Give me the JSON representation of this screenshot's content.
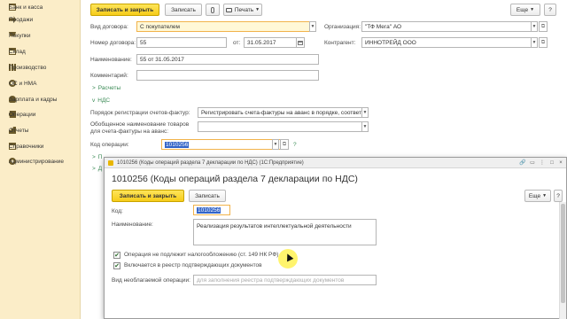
{
  "sidebar": {
    "items": [
      {
        "label": "Банк и касса",
        "icon": "bank-icon"
      },
      {
        "label": "Продажи",
        "icon": "sales-icon"
      },
      {
        "label": "Покупки",
        "icon": "purchases-icon"
      },
      {
        "label": "Склад",
        "icon": "warehouse-icon"
      },
      {
        "label": "Производство",
        "icon": "production-icon"
      },
      {
        "label": "ОС и НМА",
        "icon": "assets-icon"
      },
      {
        "label": "Зарплата и кадры",
        "icon": "hr-icon"
      },
      {
        "label": "Операции",
        "icon": "operations-icon"
      },
      {
        "label": "Отчеты",
        "icon": "reports-icon"
      },
      {
        "label": "Справочники",
        "icon": "directories-icon"
      },
      {
        "label": "Администрирование",
        "icon": "admin-icon"
      }
    ]
  },
  "toolbar": {
    "save_close": "Записать и закрыть",
    "save": "Записать",
    "print": "Печать",
    "more": "Еще",
    "help": "?"
  },
  "form": {
    "contract_type_label": "Вид договора:",
    "contract_type_value": "С покупателем",
    "organization_label": "Организация:",
    "organization_value": "\"ТФ Мега\" АО",
    "contract_no_label": "Номер договора:",
    "contract_no_value": "55",
    "from_label": "от:",
    "date_value": "31.05.2017",
    "counterparty_label": "Контрагент:",
    "counterparty_value": "ИННОТРЕЙД ООО",
    "name_label": "Наименование:",
    "name_value": "55 от 31.05.2017",
    "comment_label": "Комментарий:",
    "comment_value": "",
    "section_calc": "Расчеты",
    "section_vat": "НДС",
    "invoice_reg_label": "Порядок регистрации счетов-фактур:",
    "invoice_reg_value": "Регистрировать счета-фактуры на аванс в порядке, соответству",
    "goods_name_label": "Обобщенное наименование товаров для счета-фактуры на аванс:",
    "goods_name_value": "",
    "op_code_label": "Код операции:",
    "op_code_value": "1010256",
    "help_mark": "?",
    "hidden_section_1": "П",
    "hidden_section_2": "Д"
  },
  "dialog": {
    "window_title": "1010256 (Коды операций раздела 7 декларации по НДС) (1С:Предприятие)",
    "title": "1010256 (Коды операций раздела 7 декларации по НДС)",
    "save_close": "Записать и закрыть",
    "save": "Записать",
    "more": "Еще",
    "help": "?",
    "code_label": "Код:",
    "code_value": "1010256",
    "name_label": "Наименование:",
    "name_value": "Реализация результатов интеллектуальной деятельности",
    "check1_label": "Операция не подлежит налогообложению (ст. 149 НК РФ)",
    "check1_checked": true,
    "check2_label": "Включается в реестр подтверждающих документов",
    "check2_checked": true,
    "untaxed_label": "Вид необлагаемой операции:",
    "untaxed_placeholder": "для заполнения реестра подтверждающих документов"
  }
}
